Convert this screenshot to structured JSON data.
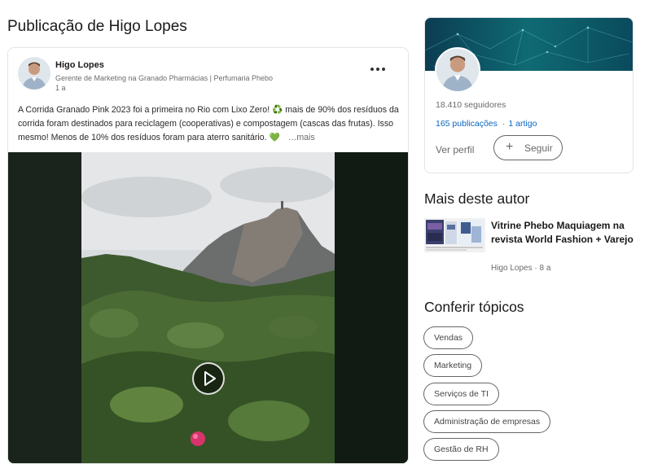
{
  "page": {
    "title": "Publicação de Higo Lopes"
  },
  "post": {
    "author_name": "Higo Lopes",
    "author_headline": "Gerente de Marketing na Granado Pharmácias | Perfumaria Phebo",
    "time": "1 a",
    "text_before_recycle": "A Corrida Granado Pink 2023 foi a primeira no Rio com Lixo Zero! ",
    "recycle_emoji": "♻️",
    "text_after_recycle": " mais de 90% dos resíduos da corrida foram destinados para reciclagem (cooperativas) e compostagem (cascas das frutas). Isso mesmo! Menos de 10% dos resíduos foram para aterro sanitário. ",
    "heart_emoji": "💚",
    "see_more": "…mais",
    "more_icon": "ellipsis-icon",
    "play_icon": "play-icon"
  },
  "profile": {
    "followers": "18.410 seguidores",
    "publications": "165 publicações",
    "articles": "1 artigo",
    "separator": "·",
    "view_profile": "Ver perfil",
    "follow_label": "Seguir",
    "follow_icon": "plus-icon"
  },
  "more_from_author": {
    "title": "Mais deste autor",
    "articles": [
      {
        "title": "Vitrine Phebo Maquiagem na revista World Fashion + Varejo",
        "author": "Higo Lopes",
        "separator": "·",
        "age": "8 a"
      }
    ]
  },
  "topics": {
    "title": "Conferir tópicos",
    "items": [
      "Vendas",
      "Marketing",
      "Serviços de TI",
      "Administração de empresas",
      "Gestão de RH"
    ]
  },
  "colors": {
    "link": "#0a66c2",
    "banner": "#0f6a74",
    "border": "#e4e4e4"
  }
}
